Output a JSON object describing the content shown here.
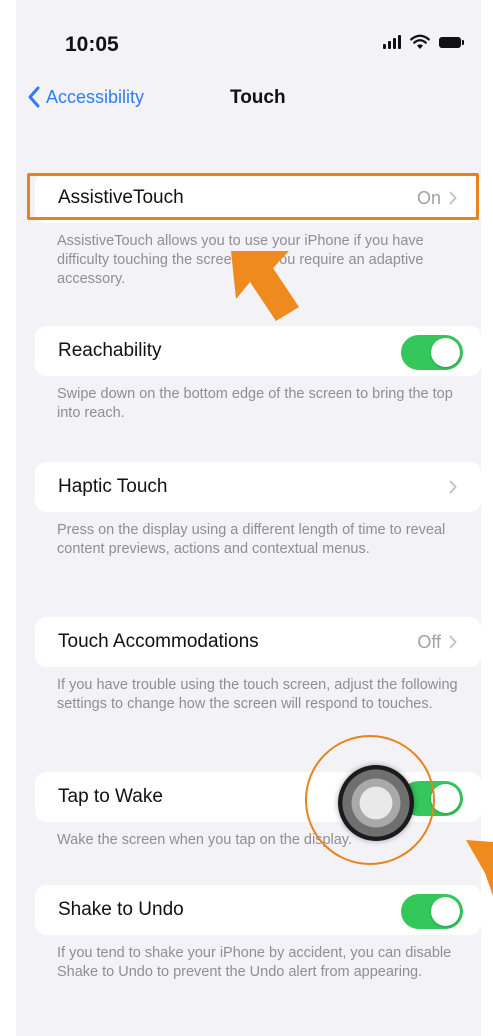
{
  "status_bar": {
    "time": "10:05",
    "icons": [
      "signal-icon",
      "wifi-icon",
      "battery-icon"
    ]
  },
  "nav": {
    "back_label": "Accessibility",
    "title": "Touch"
  },
  "settings": [
    {
      "label": "AssistiveTouch",
      "value": "On",
      "control": "disclosure",
      "footer": "AssistiveTouch allows you to use your iPhone if you have difficulty touching the screen or if you require an adaptive accessory."
    },
    {
      "label": "Reachability",
      "control": "toggle",
      "toggle_on": true,
      "footer": "Swipe down on the bottom edge of the screen to bring the top into reach."
    },
    {
      "label": "Haptic Touch",
      "value": "",
      "control": "disclosure",
      "footer": "Press on the display using a different length of time to reveal content previews, actions and contextual menus."
    },
    {
      "label": "Touch Accommodations",
      "value": "Off",
      "control": "disclosure",
      "footer": "If you have trouble using the touch screen, adjust the following settings to change how the screen will respond to touches."
    },
    {
      "label": "Tap to Wake",
      "control": "toggle",
      "toggle_on": true,
      "footer": "Wake the screen when you tap on the display."
    },
    {
      "label": "Shake to Undo",
      "control": "toggle",
      "toggle_on": true,
      "footer": "If you tend to shake your iPhone by accident, you can disable Shake to Undo to prevent the Undo alert from appearing."
    }
  ],
  "colors": {
    "accent_blue": "#2f7cf6",
    "toggle_green": "#34c759",
    "annotation_orange": "#e8831c",
    "background": "#f2f2f7"
  }
}
